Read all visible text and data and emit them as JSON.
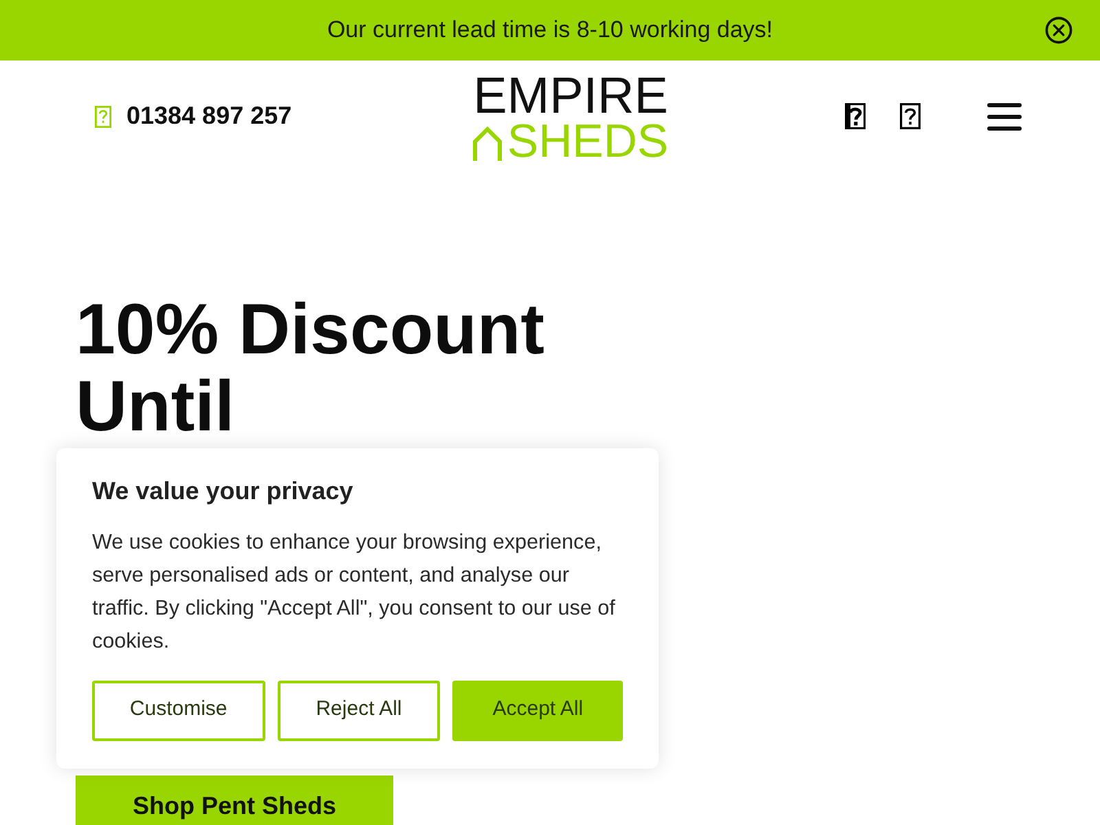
{
  "announcement_bar": {
    "text": "Our current lead time is 8-10 working days!"
  },
  "header": {
    "phone": "01384 897 257",
    "logo": {
      "line_1": "EMPIRE",
      "line_2": "SHEDS"
    }
  },
  "hero": {
    "heading": "10% Discount Until",
    "button": "Shop Pent Sheds"
  },
  "cookie_banner": {
    "title": "We value your privacy",
    "text": "We use cookies to enhance your browsing experience, serve personalised ads or content, and analyse our traffic. By clicking \"Accept All\", you consent to our use of cookies.",
    "buttons": [
      {
        "label": "Customise",
        "kind": "outline"
      },
      {
        "label": "Reject All",
        "kind": "outline"
      },
      {
        "label": "Accept All",
        "kind": "filled"
      }
    ]
  }
}
